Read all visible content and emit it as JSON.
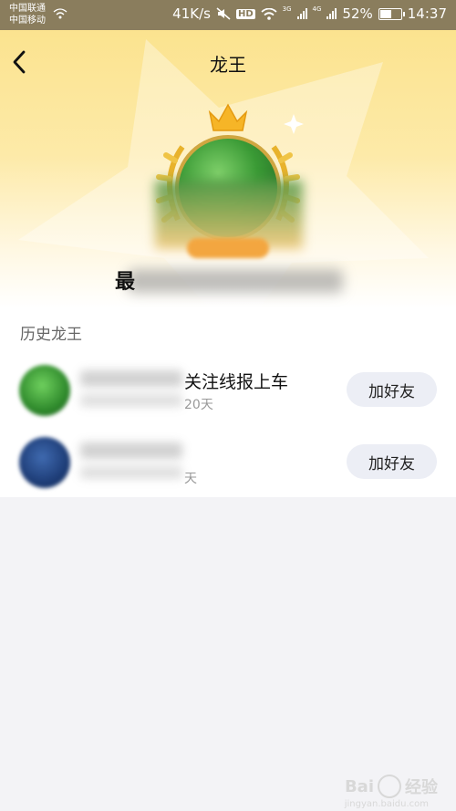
{
  "status_bar": {
    "carrier1": "中国联通",
    "carrier2": "中国移动",
    "speed": "41K/s",
    "hd": "HD",
    "net1": "3G",
    "net2": "4G",
    "battery": "52%",
    "battery_level": 0.52,
    "time": "14:37"
  },
  "header": {
    "title": "龙王"
  },
  "hero": {
    "nickname_first_char": "最"
  },
  "history": {
    "section_title": "历史龙王",
    "rows": [
      {
        "visible_text": "关注线报上车",
        "sub_text": "20天",
        "button": "加好友"
      },
      {
        "visible_text": "",
        "sub_text": "天",
        "button": "加好友"
      }
    ]
  },
  "watermark": {
    "brand": "Bai",
    "brand_cn": "经验",
    "url": "jingyan.baidu.com"
  },
  "colors": {
    "status_bg": "#8a7d5d",
    "hero_top": "#fbe38f",
    "button_bg": "#eceef5",
    "page_bg": "#f3f3f6"
  }
}
